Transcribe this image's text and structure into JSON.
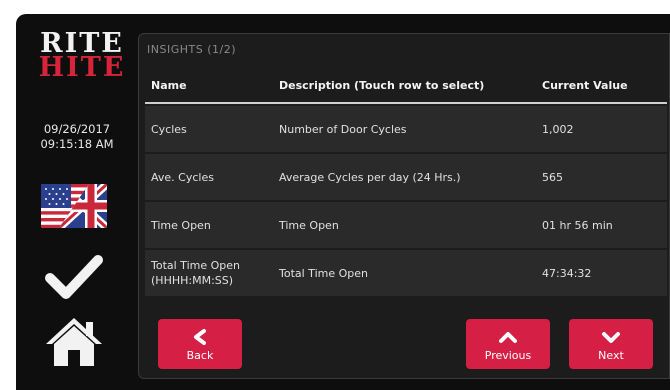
{
  "brand": {
    "line1": "RITE",
    "line2": "HITE"
  },
  "datetime": {
    "date": "09/26/2017",
    "time": "09:15:18 AM"
  },
  "sidebar": {
    "language_icon": "us-uk-flag-icon",
    "confirm_icon": "checkmark-icon",
    "home_icon": "home-icon"
  },
  "panel": {
    "title": "INSIGHTS (1/2)"
  },
  "table": {
    "headers": [
      "Name",
      "Description (Touch row to select)",
      "Current Value"
    ],
    "rows": [
      {
        "name": "Cycles",
        "name_sub": "",
        "description": "Number of Door Cycles",
        "value": "1,002"
      },
      {
        "name": "Ave. Cycles",
        "name_sub": "",
        "description": "Average Cycles per day (24 Hrs.)",
        "value": "565"
      },
      {
        "name": "Time Open",
        "name_sub": "",
        "description": "Time Open",
        "value": "01 hr 56 min"
      },
      {
        "name": "Total Time Open",
        "name_sub": "(HHHH:MM:SS)",
        "description": "Total Time Open",
        "value": "47:34:32"
      }
    ]
  },
  "buttons": {
    "back": "Back",
    "previous": "Previous",
    "next": "Next"
  },
  "colors": {
    "accent": "#d51f45",
    "background": "#0e0e0e",
    "row": "#2a2a2a"
  }
}
